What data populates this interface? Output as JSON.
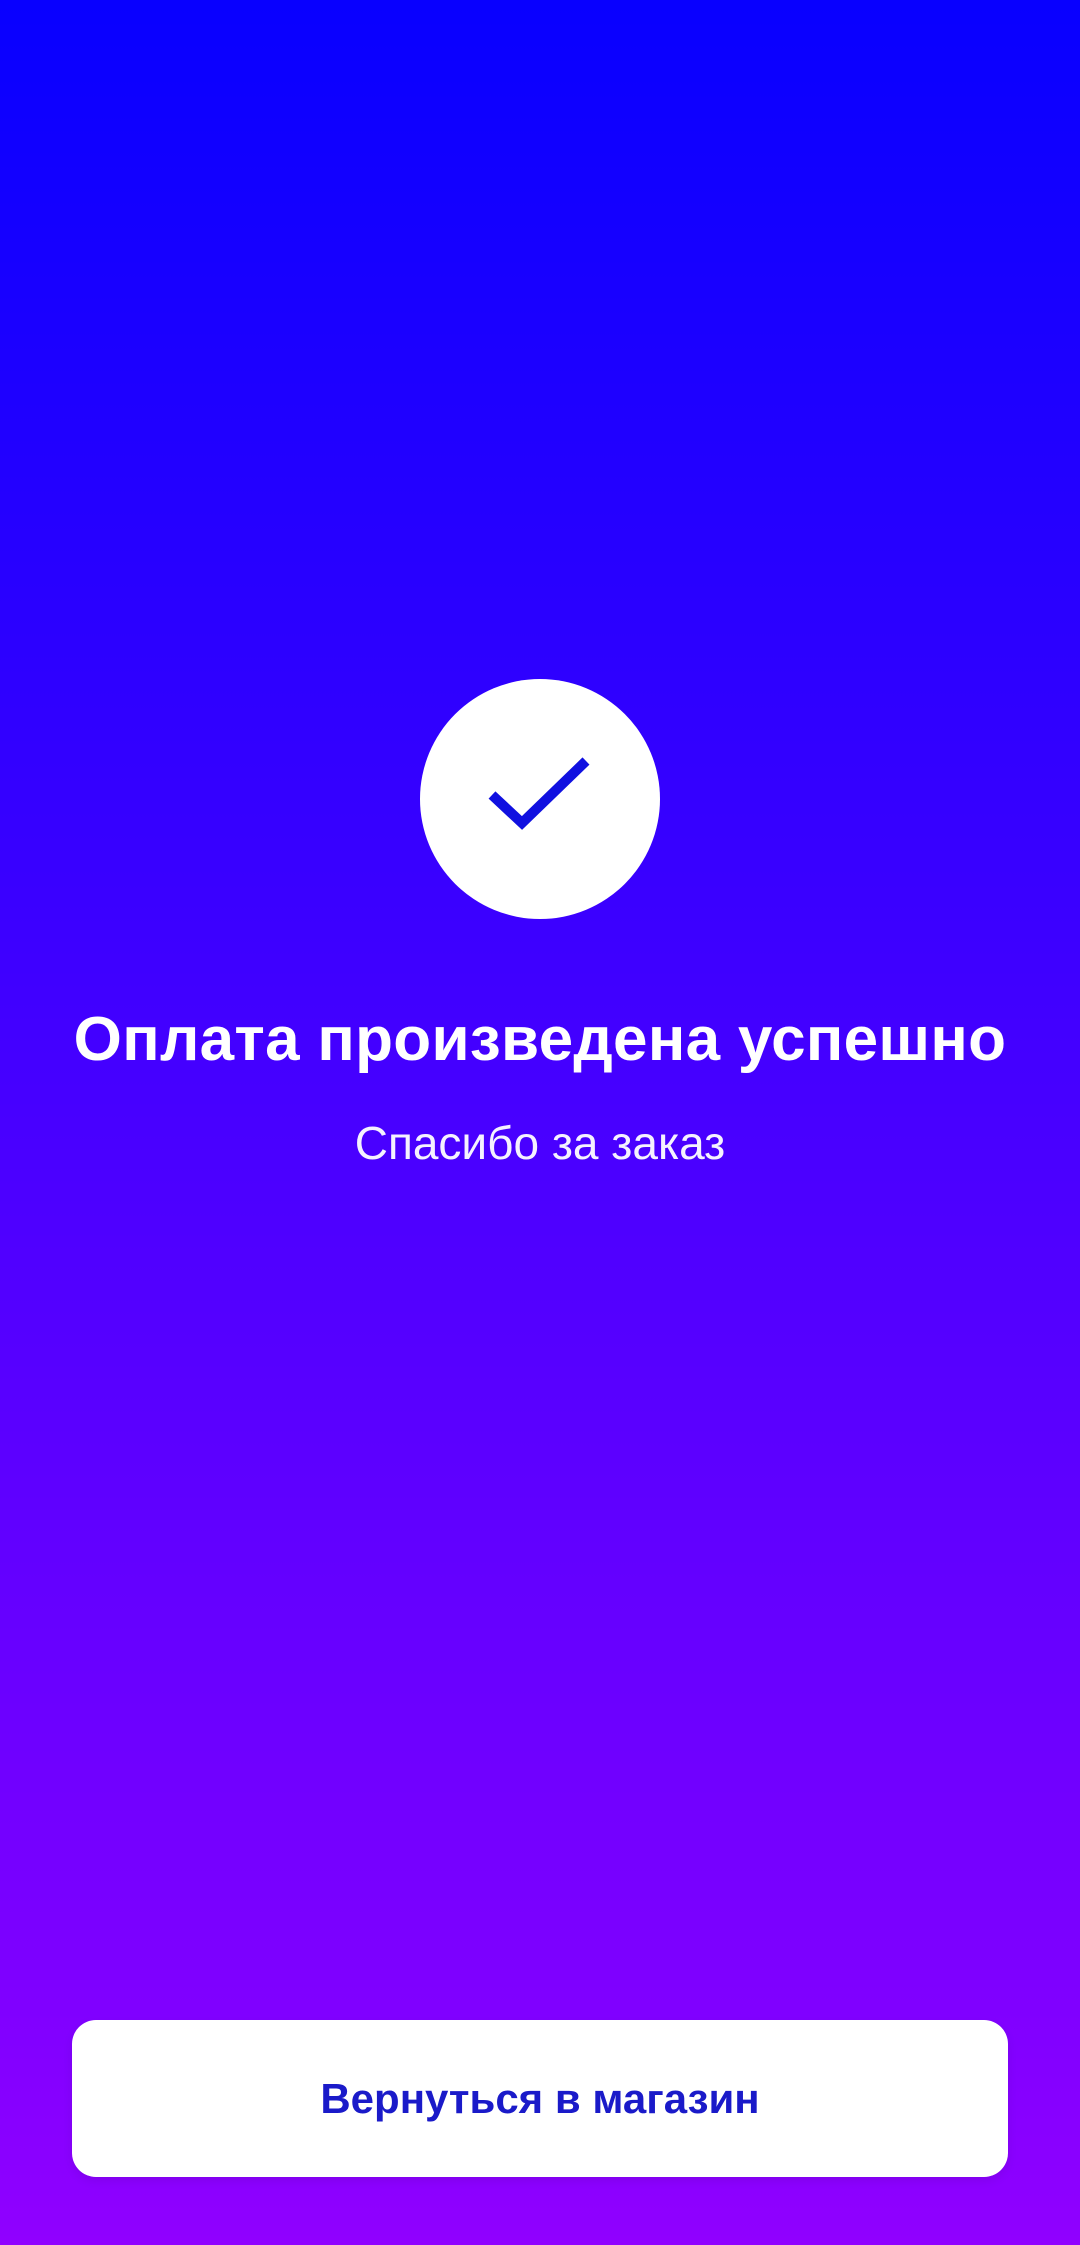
{
  "success": {
    "icon": "checkmark-icon",
    "title": "Оплата произведена успешно",
    "subtitle": "Спасибо за заказ"
  },
  "actions": {
    "return_label": "Вернуться в магазин"
  },
  "colors": {
    "gradient_top": "#0800ff",
    "gradient_bottom": "#9000ff",
    "accent": "#1a1ac9",
    "checkmark": "#1010e0"
  }
}
